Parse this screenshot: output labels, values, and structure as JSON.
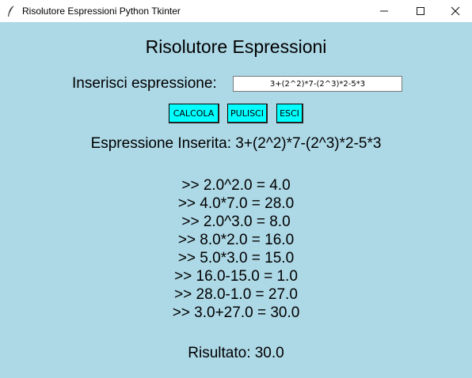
{
  "window": {
    "title": "Risolutore Espressioni Python Tkinter",
    "icons": {
      "app": "feather-icon",
      "minimize": "minimize-icon",
      "maximize": "maximize-icon",
      "close": "close-icon"
    }
  },
  "main": {
    "heading": "Risolutore Espressioni",
    "input_label": "Inserisci espressione:",
    "input_value": "3+(2^2)*7-(2^3)*2-5*3",
    "buttons": {
      "calcola": "CALCOLA",
      "pulisci": "PULISCI",
      "esci": "ESCI"
    },
    "expression_display": "Espressione Inserita: 3+(2^2)*7-(2^3)*2-5*3",
    "steps": [
      ">> 2.0^2.0 = 4.0",
      ">> 4.0*7.0 = 28.0",
      ">> 2.0^3.0 = 8.0",
      ">> 8.0*2.0 = 16.0",
      ">> 5.0*3.0 = 15.0",
      ">> 16.0-15.0 = 1.0",
      ">> 28.0-1.0 = 27.0",
      ">> 3.0+27.0 = 30.0"
    ],
    "result": "Risultato: 30.0"
  },
  "colors": {
    "background": "#add8e6",
    "button": "#00ffff",
    "titlebar": "#ffffff"
  }
}
